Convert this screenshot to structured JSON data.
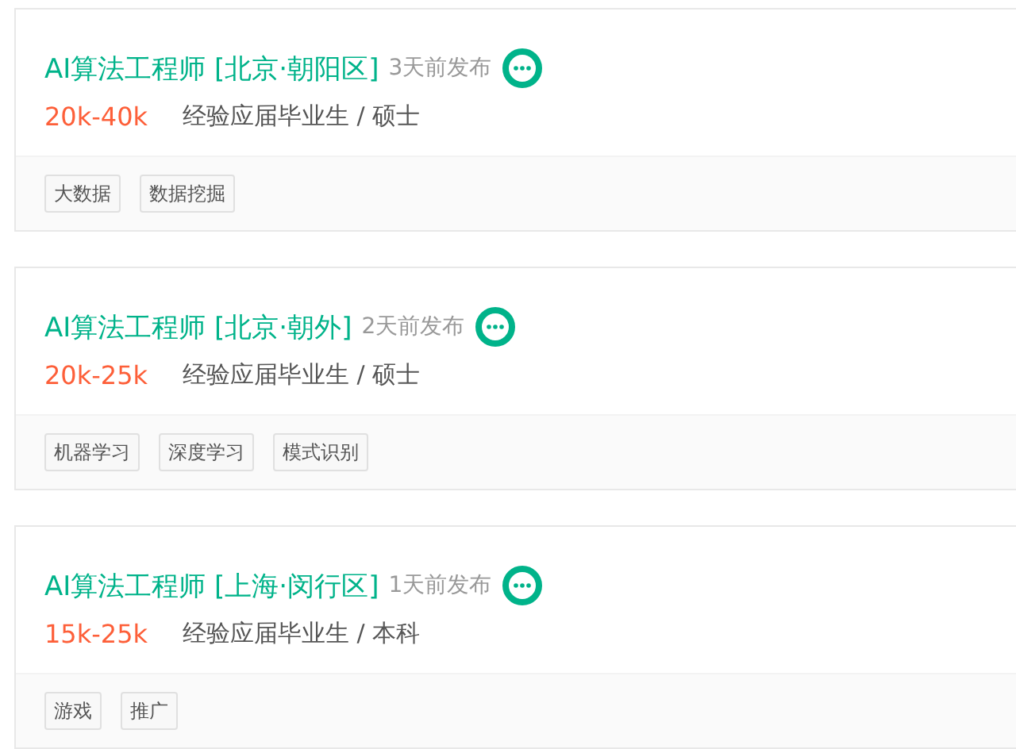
{
  "jobs": [
    {
      "title": "AI算法工程师 [北京·朝阳区]",
      "posted": "3天前发布",
      "salary": "20k-40k",
      "requirements": "经验应届毕业生 / 硕士",
      "tags": [
        "大数据",
        "数据挖掘"
      ]
    },
    {
      "title": "AI算法工程师 [北京·朝外]",
      "posted": "2天前发布",
      "salary": "20k-25k",
      "requirements": "经验应届毕业生 / 硕士",
      "tags": [
        "机器学习",
        "深度学习",
        "模式识别"
      ]
    },
    {
      "title": "AI算法工程师 [上海·闵行区]",
      "posted": "1天前发布",
      "salary": "15k-25k",
      "requirements": "经验应届毕业生 / 本科",
      "tags": [
        "游戏",
        "推广"
      ]
    }
  ]
}
